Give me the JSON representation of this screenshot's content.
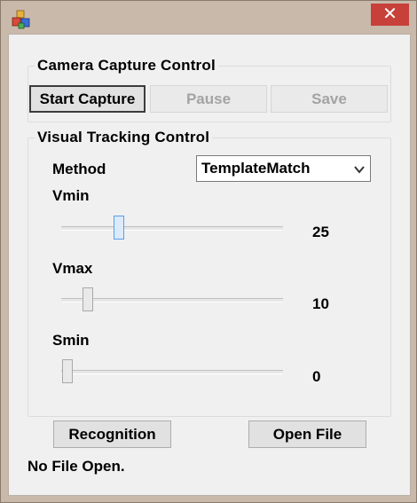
{
  "window": {
    "close_glyph": "✕",
    "icon": "app-cubes-icon"
  },
  "camera_group": {
    "title": "Camera Capture Control",
    "start_label": "Start Capture",
    "pause_label": "Pause",
    "save_label": "Save"
  },
  "tracking_group": {
    "title": "Visual Tracking Control",
    "method_label": "Method",
    "method_value": "TemplateMatch",
    "sliders": [
      {
        "label": "Vmin",
        "value": "25"
      },
      {
        "label": "Vmax",
        "value": "10"
      },
      {
        "label": "Smin",
        "value": "0"
      }
    ]
  },
  "actions": {
    "recognition_label": "Recognition",
    "open_file_label": "Open File"
  },
  "status_text": "No File Open.",
  "colors": {
    "close": "#c7403a",
    "frame": "#c9b9ab",
    "client": "#f0f0f0",
    "focus_thumb": "#5a9fe6"
  }
}
